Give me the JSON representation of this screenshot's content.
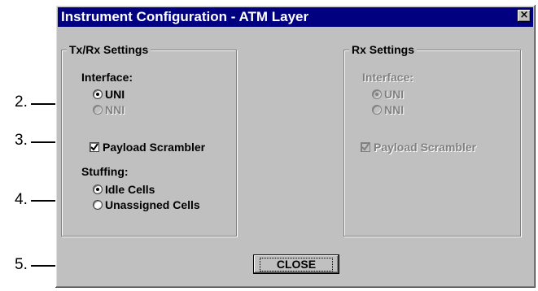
{
  "callouts": [
    "2.",
    "3.",
    "4.",
    "5."
  ],
  "window": {
    "title": "Instrument Configuration - ATM Layer",
    "close_glyph": "×"
  },
  "txrx": {
    "legend": "Tx/Rx Settings",
    "interface_label": "Interface:",
    "interface_options": [
      {
        "label": "UNI",
        "selected": true,
        "enabled": true
      },
      {
        "label": "NNI",
        "selected": false,
        "enabled": false
      }
    ],
    "payload_scrambler": {
      "label": "Payload Scrambler",
      "checked": true
    },
    "stuffing_label": "Stuffing:",
    "stuffing_options": [
      {
        "label": "Idle Cells",
        "selected": true
      },
      {
        "label": "Unassigned Cells",
        "selected": false
      }
    ]
  },
  "rx": {
    "legend": "Rx Settings",
    "interface_label": "Interface:",
    "interface_options": [
      {
        "label": "UNI",
        "selected": true,
        "enabled": false
      },
      {
        "label": "NNI",
        "selected": false,
        "enabled": false
      }
    ],
    "payload_scrambler": {
      "label": "Payload Scrambler",
      "checked": true,
      "enabled": false
    }
  },
  "close_button_label": "CLOSE",
  "colors": {
    "titlebar": "#000080",
    "face": "#c0c0c0",
    "disabled_text": "#808080"
  }
}
